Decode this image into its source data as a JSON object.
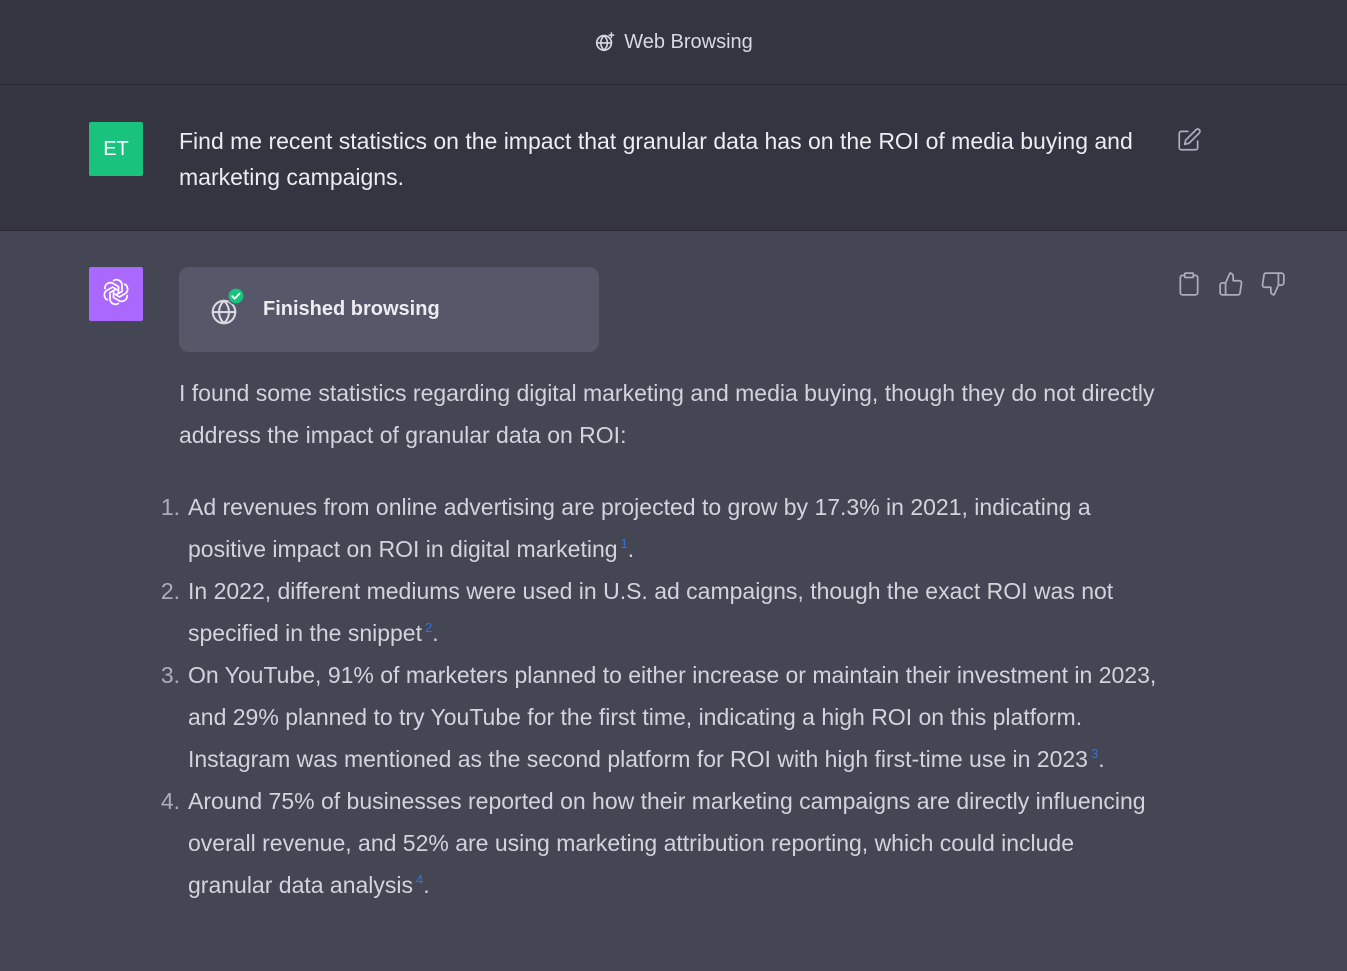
{
  "header": {
    "title": "Web Browsing",
    "icon": "globe-sparkle-icon"
  },
  "user": {
    "avatar_initials": "ET",
    "avatar_color": "#19c37d",
    "message": "Find me  recent statistics on the impact that granular data has on the ROI of media buying and marketing campaigns."
  },
  "assistant": {
    "avatar_color": "#ab68ff",
    "browse_status": "Finished browsing",
    "intro": "I found some statistics regarding digital marketing and media buying, though they do not directly address the impact of granular data on ROI:",
    "items": [
      {
        "number": "1.",
        "text": "Ad revenues from online advertising are projected to grow by 17.3% in 2021, indicating a positive impact on ROI in digital marketing",
        "cite": "1"
      },
      {
        "number": "2.",
        "text": "In 2022, different mediums were used in U.S. ad campaigns, though the exact ROI was not specified in the snippet",
        "cite": "2"
      },
      {
        "number": "3.",
        "text": "On YouTube, 91% of marketers planned to either increase or maintain their investment in 2023, and 29% planned to try YouTube for the first time, indicating a high ROI on this platform. Instagram was mentioned as the second platform for ROI with high first-time use in 2023",
        "cite": "3"
      },
      {
        "number": "4.",
        "text": "Around 75% of businesses reported on how their marketing campaigns are directly influencing overall revenue, and 52% are using marketing attribution reporting, which could include granular data analysis",
        "cite": "4"
      }
    ],
    "item_terminator": "."
  },
  "colors": {
    "page_bg": "#444654",
    "user_row_bg": "#343541",
    "card_bg": "#565869",
    "citation": "#3b6fd6",
    "check": "#19c37d"
  }
}
